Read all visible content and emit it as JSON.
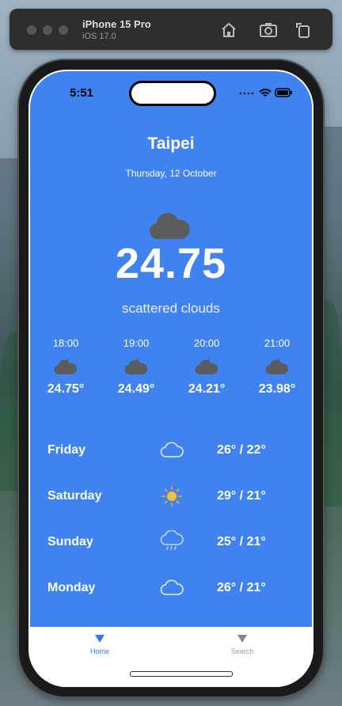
{
  "simulator": {
    "device_name": "iPhone 15 Pro",
    "os_version": "iOS 17.0",
    "buttons": [
      "home-icon",
      "screenshot-icon",
      "rotate-icon"
    ]
  },
  "status_bar": {
    "time": "5:51"
  },
  "weather": {
    "city": "Taipei",
    "date": "Thursday, 12 October",
    "temperature": "24.75",
    "description": "scattered clouds",
    "icon": "cloud-moon-icon"
  },
  "hourly": [
    {
      "time": "18:00",
      "temp": "24.75°",
      "icon": "cloud-moon-icon"
    },
    {
      "time": "19:00",
      "temp": "24.49°",
      "icon": "cloud-moon-icon"
    },
    {
      "time": "20:00",
      "temp": "24.21°",
      "icon": "cloud-moon-icon"
    },
    {
      "time": "21:00",
      "temp": "23.98°",
      "icon": "cloud-moon-icon"
    }
  ],
  "daily": [
    {
      "day": "Friday",
      "temp": "26° / 22°",
      "icon": "cloud-icon"
    },
    {
      "day": "Saturday",
      "temp": "29° / 21°",
      "icon": "sun-icon"
    },
    {
      "day": "Sunday",
      "temp": "25° / 21°",
      "icon": "rain-cloud-icon"
    },
    {
      "day": "Monday",
      "temp": "26° / 21°",
      "icon": "cloud-icon"
    }
  ],
  "tabs": [
    {
      "label": "Home",
      "active": true
    },
    {
      "label": "Search",
      "active": false
    }
  ],
  "colors": {
    "screen_bg": "#3f83f0",
    "active_tab": "#2f7af0"
  }
}
